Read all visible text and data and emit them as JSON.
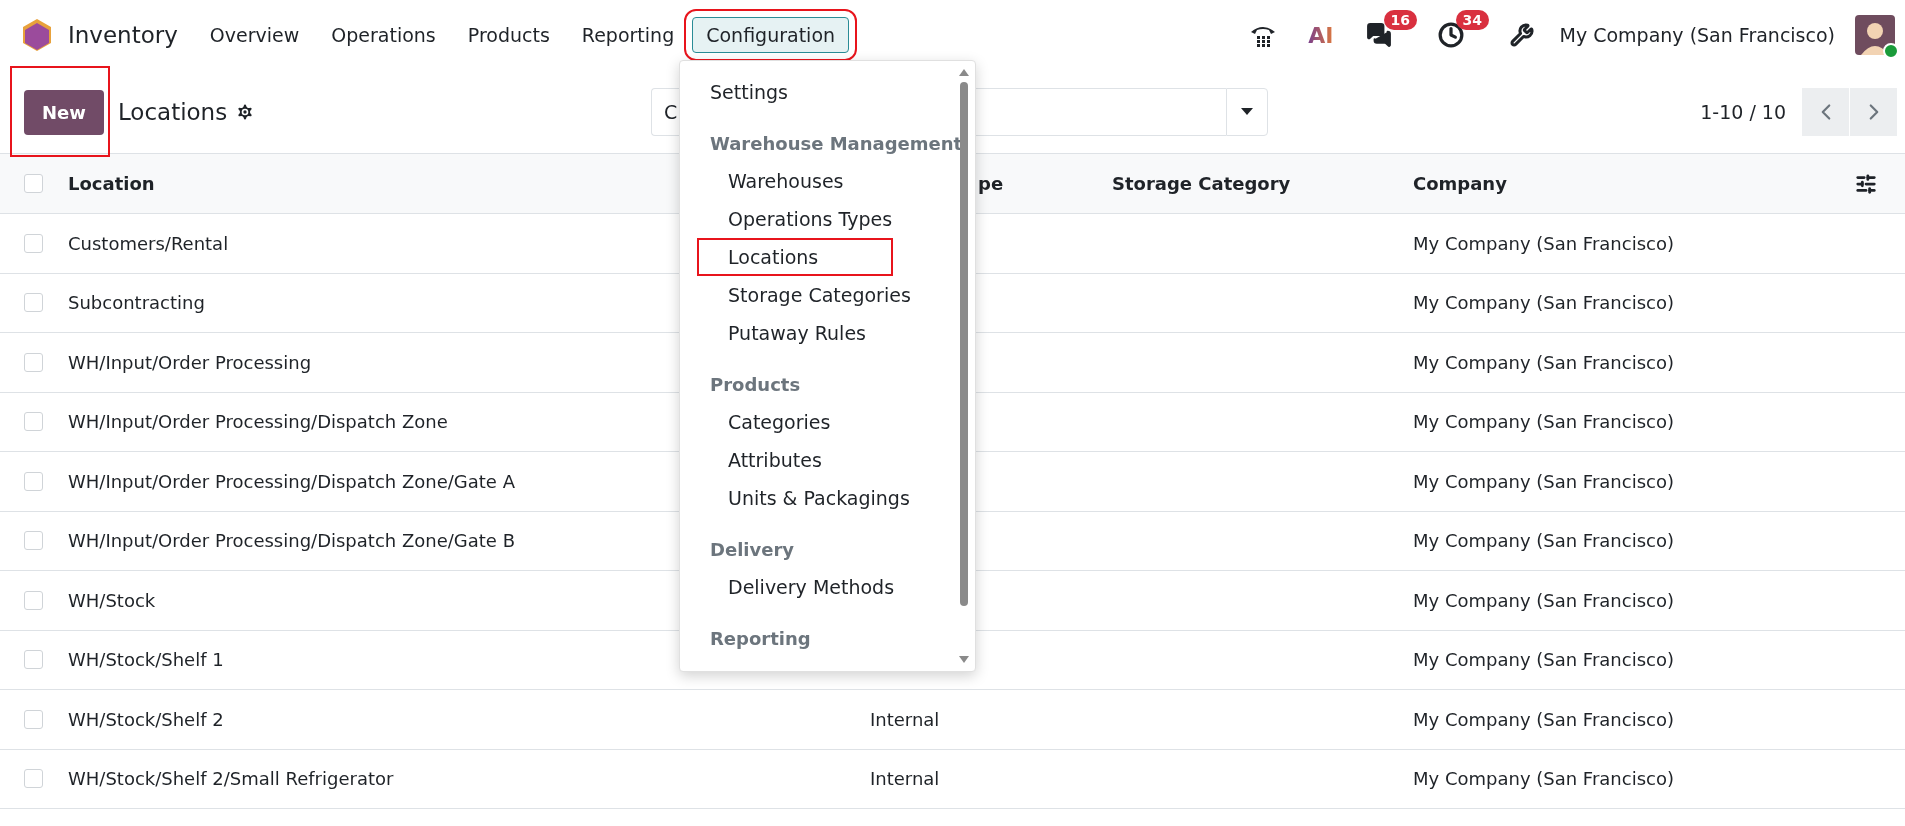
{
  "navbar": {
    "app_name": "Inventory",
    "menus": [
      {
        "label": "Overview",
        "selected": false,
        "highlighted": false
      },
      {
        "label": "Operations",
        "selected": false,
        "highlighted": false
      },
      {
        "label": "Products",
        "selected": false,
        "highlighted": false
      },
      {
        "label": "Reporting",
        "selected": false,
        "highlighted": false
      },
      {
        "label": "Configuration",
        "selected": true,
        "highlighted": true
      }
    ],
    "ai_label": "AI",
    "messages_badge": "16",
    "activities_badge": "34",
    "company": "My Company (San Francisco)"
  },
  "control_panel": {
    "new_button": {
      "label": "New",
      "highlighted": true
    },
    "title": "Locations",
    "search": {
      "value": "C"
    },
    "pager": "1-10 / 10"
  },
  "table": {
    "select_all_checked": false,
    "columns": [
      "Location",
      "pe",
      "Storage Category",
      "Company"
    ],
    "rows": [
      {
        "checked": false,
        "cells": [
          "Customers/Rental",
          "",
          "",
          "My Company (San Francisco)"
        ]
      },
      {
        "checked": false,
        "cells": [
          "Subcontracting",
          "",
          "",
          "My Company (San Francisco)"
        ]
      },
      {
        "checked": false,
        "cells": [
          "WH/Input/Order Processing",
          "",
          "",
          "My Company (San Francisco)"
        ]
      },
      {
        "checked": false,
        "cells": [
          "WH/Input/Order Processing/Dispatch Zone",
          "",
          "",
          "My Company (San Francisco)"
        ]
      },
      {
        "checked": false,
        "cells": [
          "WH/Input/Order Processing/Dispatch Zone/Gate A",
          "",
          "",
          "My Company (San Francisco)"
        ]
      },
      {
        "checked": false,
        "cells": [
          "WH/Input/Order Processing/Dispatch Zone/Gate B",
          "",
          "",
          "My Company (San Francisco)"
        ]
      },
      {
        "checked": false,
        "cells": [
          "WH/Stock",
          "",
          "",
          "My Company (San Francisco)"
        ]
      },
      {
        "checked": false,
        "cells": [
          "WH/Stock/Shelf 1",
          "",
          "",
          "My Company (San Francisco)"
        ]
      },
      {
        "checked": false,
        "cells": [
          "WH/Stock/Shelf 2",
          "Internal",
          "",
          "My Company (San Francisco)"
        ]
      },
      {
        "checked": false,
        "cells": [
          "WH/Stock/Shelf 2/Small Refrigerator",
          "Internal",
          "",
          "My Company (San Francisco)"
        ]
      }
    ]
  },
  "dropdown": {
    "entries": [
      {
        "kind": "item",
        "label": "Settings",
        "highlighted": false
      },
      {
        "kind": "section",
        "label": "Warehouse Management"
      },
      {
        "kind": "subitem",
        "label": "Warehouses",
        "highlighted": false
      },
      {
        "kind": "subitem",
        "label": "Operations Types",
        "highlighted": false
      },
      {
        "kind": "subitem",
        "label": "Locations",
        "highlighted": true
      },
      {
        "kind": "subitem",
        "label": "Storage Categories",
        "highlighted": false
      },
      {
        "kind": "subitem",
        "label": "Putaway Rules",
        "highlighted": false
      },
      {
        "kind": "section",
        "label": "Products"
      },
      {
        "kind": "subitem",
        "label": "Categories",
        "highlighted": false
      },
      {
        "kind": "subitem",
        "label": "Attributes",
        "highlighted": false
      },
      {
        "kind": "subitem",
        "label": "Units & Packagings",
        "highlighted": false
      },
      {
        "kind": "section",
        "label": "Delivery"
      },
      {
        "kind": "subitem",
        "label": "Delivery Methods",
        "highlighted": false
      },
      {
        "kind": "section",
        "label": "Reporting"
      }
    ]
  }
}
